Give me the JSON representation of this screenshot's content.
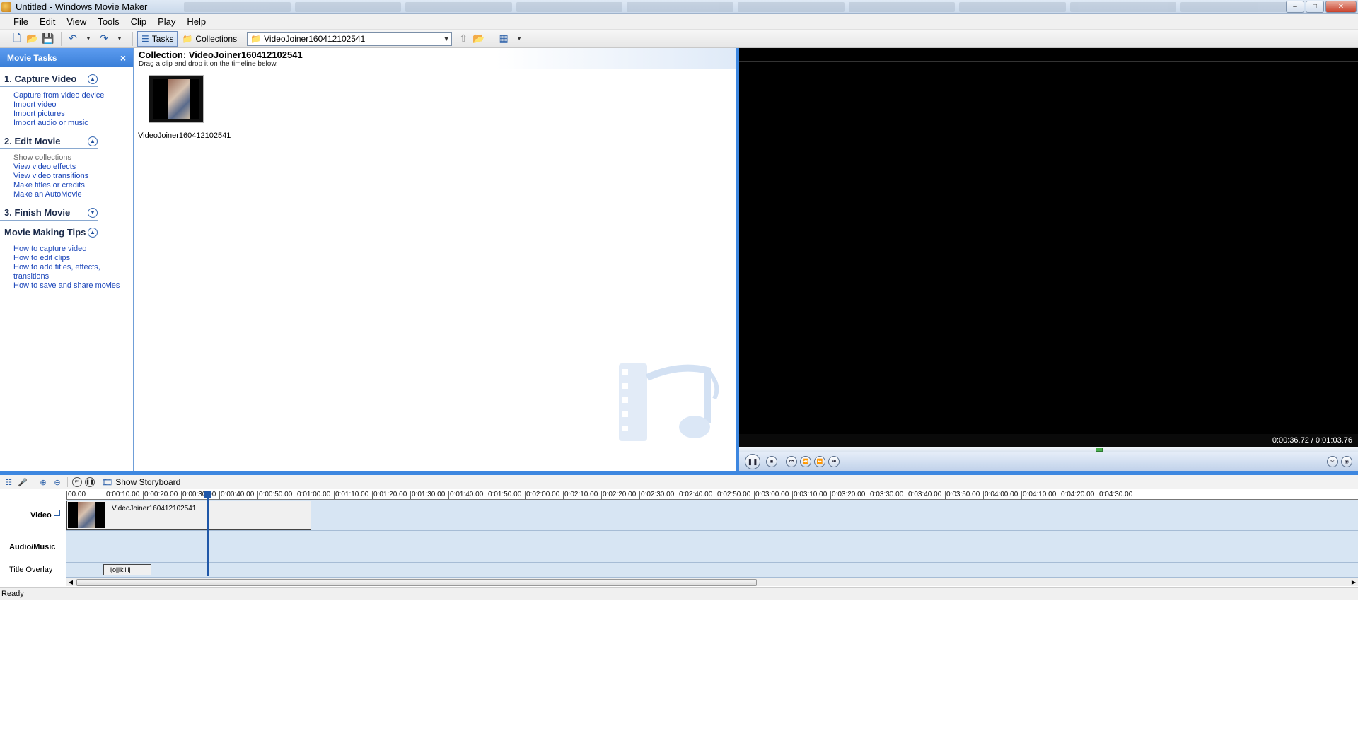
{
  "window": {
    "title": "Untitled - Windows Movie Maker",
    "minimize": "–",
    "maximize": "□",
    "close": "✕"
  },
  "menu": [
    "File",
    "Edit",
    "View",
    "Tools",
    "Clip",
    "Play",
    "Help"
  ],
  "toolbar": {
    "tasks_label": "Tasks",
    "collections_label": "Collections",
    "collection_combo_value": "VideoJoiner160412102541"
  },
  "taskpane": {
    "header": "Movie Tasks",
    "close": "×",
    "sections": [
      {
        "title": "1. Capture Video",
        "state": "expanded",
        "links": [
          "Capture from video device",
          "Import video",
          "Import pictures",
          "Import audio or music"
        ]
      },
      {
        "title": "2. Edit Movie",
        "state": "expanded",
        "links": [
          "Show collections",
          "View video effects",
          "View video transitions",
          "Make titles or credits",
          "Make an AutoMovie"
        ]
      },
      {
        "title": "3. Finish Movie",
        "state": "collapsed",
        "links": []
      },
      {
        "title": "Movie Making Tips",
        "state": "expanded",
        "links": [
          "How to capture video",
          "How to edit clips",
          "How to add titles, effects, transitions",
          "How to save and share movies"
        ]
      }
    ]
  },
  "collection": {
    "title": "Collection: VideoJoiner160412102541",
    "hint": "Drag a clip and drop it on the timeline below.",
    "clip_name": "VideoJoiner160412102541"
  },
  "monitor": {
    "time": "0:00:36.72 / 0:01:03.76",
    "progress": 0.576
  },
  "timeline": {
    "show_storyboard": "Show Storyboard",
    "ticks": [
      "00.00",
      "0:00:10.00",
      "0:00:20.00",
      "0:00:30.00",
      "0:00:40.00",
      "0:00:50.00",
      "0:01:00.00",
      "0:01:10.00",
      "0:01:20.00",
      "0:01:30.00",
      "0:01:40.00",
      "0:01:50.00",
      "0:02:00.00",
      "0:02:10.00",
      "0:02:20.00",
      "0:02:30.00",
      "0:02:40.00",
      "0:02:50.00",
      "0:03:00.00",
      "0:03:10.00",
      "0:03:20.00",
      "0:03:30.00",
      "0:03:40.00",
      "0:03:50.00",
      "0:04:00.00",
      "0:04:10.00",
      "0:04:20.00",
      "0:04:30.00"
    ],
    "tracks": {
      "video": "Video",
      "audio": "Audio/Music",
      "title_overlay": "Title Overlay"
    },
    "video_clip_name": "VideoJoiner160412102541",
    "title_clip_text": "ijojjikjiiij"
  },
  "status": "Ready"
}
